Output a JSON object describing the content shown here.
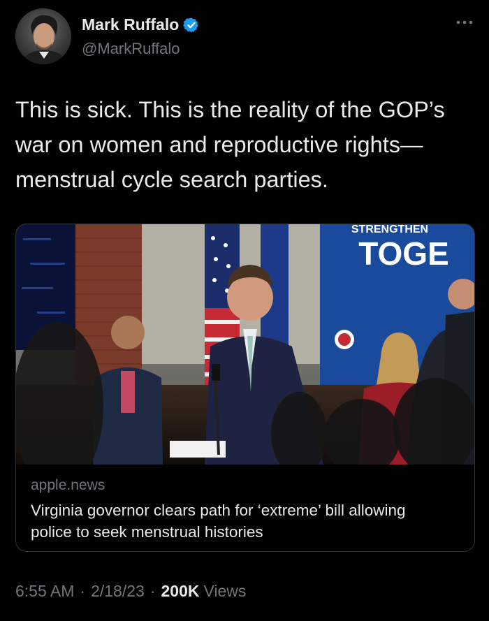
{
  "author": {
    "display_name": "Mark Ruffalo",
    "handle": "@MarkRuffalo",
    "verified": true,
    "avatar_icon": "person-avatar"
  },
  "more_icon": "ellipsis-icon",
  "tweet": {
    "text": "This is sick. This is the reality of the GOP’s war on women and reproductive rights—menstrual cycle search parties."
  },
  "card": {
    "domain": "apple.news",
    "title": "Virginia governor clears path for ‘extreme’ bill allowing police to seek menstrual histories",
    "image_banner_text": "TOGE",
    "image_banner_top_text": "STRENGTHEN"
  },
  "meta": {
    "time": "6:55 AM",
    "separator": "·",
    "date": "2/18/23",
    "views_count": "200K",
    "views_label": "Views"
  },
  "colors": {
    "background": "#000000",
    "text_primary": "#e7e9ea",
    "text_secondary": "#71767b",
    "verified_blue": "#1d9bf0",
    "card_border": "#2f3336"
  }
}
